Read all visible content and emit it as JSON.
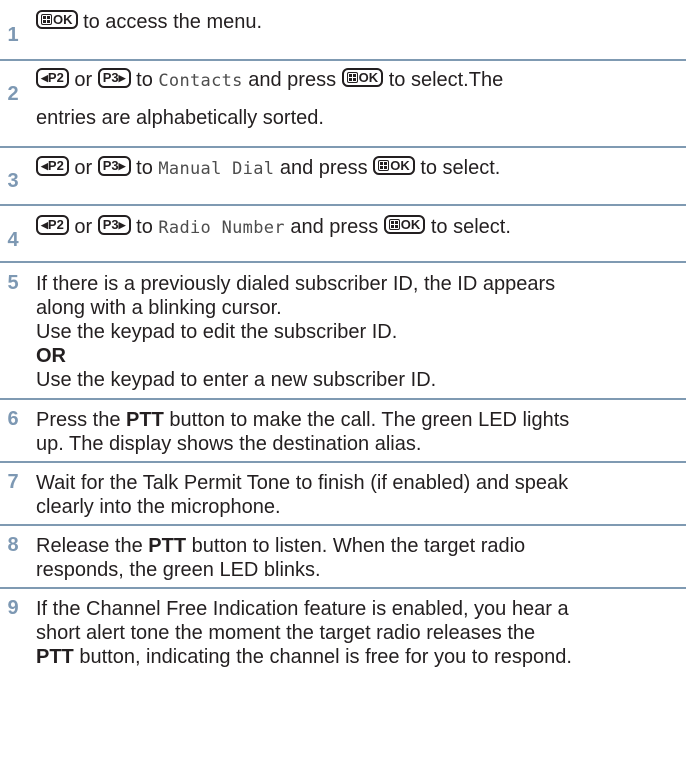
{
  "keys": {
    "ok": "OK",
    "p2": "P2",
    "p3": "P3"
  },
  "lcd": {
    "contacts": "Contacts",
    "manual_dial": "Manual Dial",
    "radio_number": "Radio Number"
  },
  "steps": [
    {
      "number": "1",
      "text_a": "to access the menu."
    },
    {
      "number": "2",
      "or": "or",
      "to": "to",
      "and_press": "and press",
      "to_select": "to select.The",
      "line2": "entries are alphabetically sorted."
    },
    {
      "number": "3",
      "or": "or",
      "to": "to",
      "and_press": "and press",
      "to_select": "to select."
    },
    {
      "number": "4",
      "or": "or",
      "to": "to",
      "and_press": "and press",
      "to_select": "to select."
    },
    {
      "number": "5",
      "line1": "If there is a previously dialed subscriber ID, the ID appears",
      "line2": "along with a blinking cursor.",
      "line3": "Use the keypad to edit the subscriber ID.",
      "line4": "OR",
      "line5": "Use the keypad to enter a new subscriber ID."
    },
    {
      "number": "6",
      "a": "Press the ",
      "b": "PTT",
      "c": " button to make the call. The green LED lights",
      "line2": "up. The display shows the destination alias."
    },
    {
      "number": "7",
      "line1": "Wait for the Talk Permit Tone to finish (if enabled) and speak",
      "line2": "clearly into the microphone."
    },
    {
      "number": "8",
      "a": "Release the ",
      "b": "PTT",
      "c": " button to listen. When the target radio",
      "line2": "responds, the green LED blinks."
    },
    {
      "number": "9",
      "line1": "If the Channel Free Indication feature is enabled, you hear a",
      "line2": "short alert tone the moment the target radio releases the",
      "b": "PTT",
      "c": " button, indicating the channel is free for you to respond."
    }
  ]
}
